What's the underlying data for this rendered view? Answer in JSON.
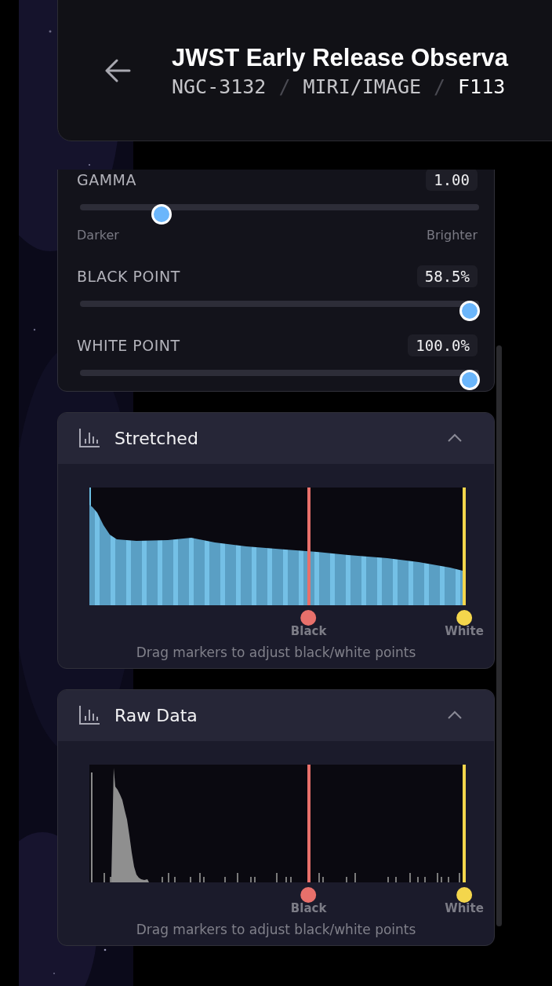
{
  "header": {
    "title": "JWST Early Release Observa",
    "breadcrumb": [
      "NGC-3132",
      "MIRI/IMAGE",
      "F113"
    ],
    "separator": "/"
  },
  "adjustments": {
    "sliders": [
      {
        "label": "GAMMA",
        "value": "1.00",
        "level": 0.19,
        "min_label": "Darker",
        "max_label": "Brighter"
      },
      {
        "label": "BLACK POINT",
        "value": "58.5%",
        "level": 1
      },
      {
        "label": "WHITE POINT",
        "value": "100.0%",
        "level": 1
      }
    ]
  },
  "histograms": [
    {
      "kind": "stretched",
      "title": "Stretched",
      "expanded": true,
      "markers": [
        {
          "label": "Black",
          "level": 0.585,
          "color": "#e8706b"
        },
        {
          "label": "White",
          "level": 1,
          "color": "#f4d64c"
        }
      ],
      "caption": "Drag markers to adjust black/white points"
    },
    {
      "kind": "raw",
      "title": "Raw Data",
      "expanded": true,
      "markers": [
        {
          "label": "Black",
          "level": 0.585,
          "color": "#e8706b"
        },
        {
          "label": "White",
          "level": 1,
          "color": "#f4d64c"
        }
      ],
      "caption": "Drag markers to adjust black/white points"
    }
  ]
}
